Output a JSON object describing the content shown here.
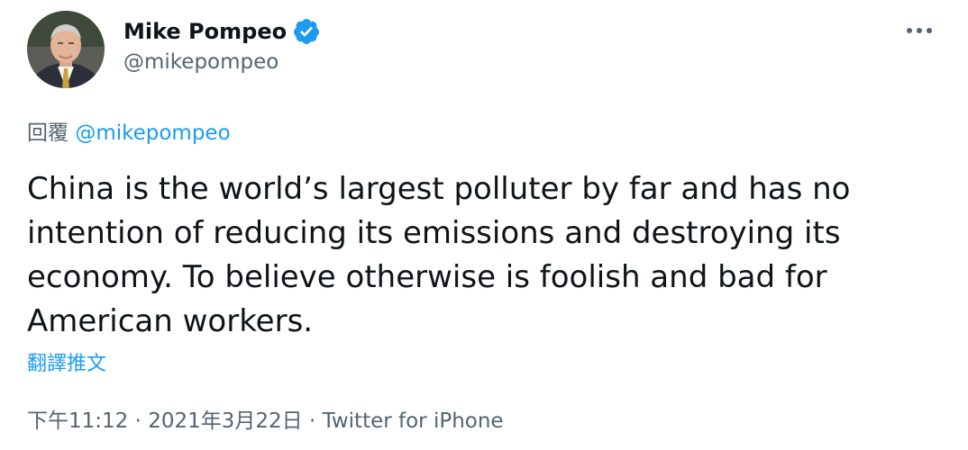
{
  "author": {
    "display_name": "Mike Pompeo",
    "handle": "@mikepompeo",
    "verified": true,
    "verified_icon": "verified-badge-icon",
    "avatar_icon": "profile-avatar"
  },
  "menu": {
    "more_icon": "more-horizontal-icon"
  },
  "reply": {
    "prefix": "回覆",
    "mention": "@mikepompeo"
  },
  "tweet": {
    "text": "China is the world’s largest polluter by far and has no intention of reducing its emissions and destroying its economy. To believe otherwise is foolish and bad for American workers."
  },
  "translate": {
    "label": "翻譯推文"
  },
  "meta": {
    "time": "下午11:12",
    "separator1": " · ",
    "date": "2021年3月22日",
    "separator2": " · ",
    "source": "Twitter for iPhone"
  },
  "colors": {
    "text": "#0f1419",
    "secondary": "#536471",
    "accent": "#1d9bf0"
  }
}
